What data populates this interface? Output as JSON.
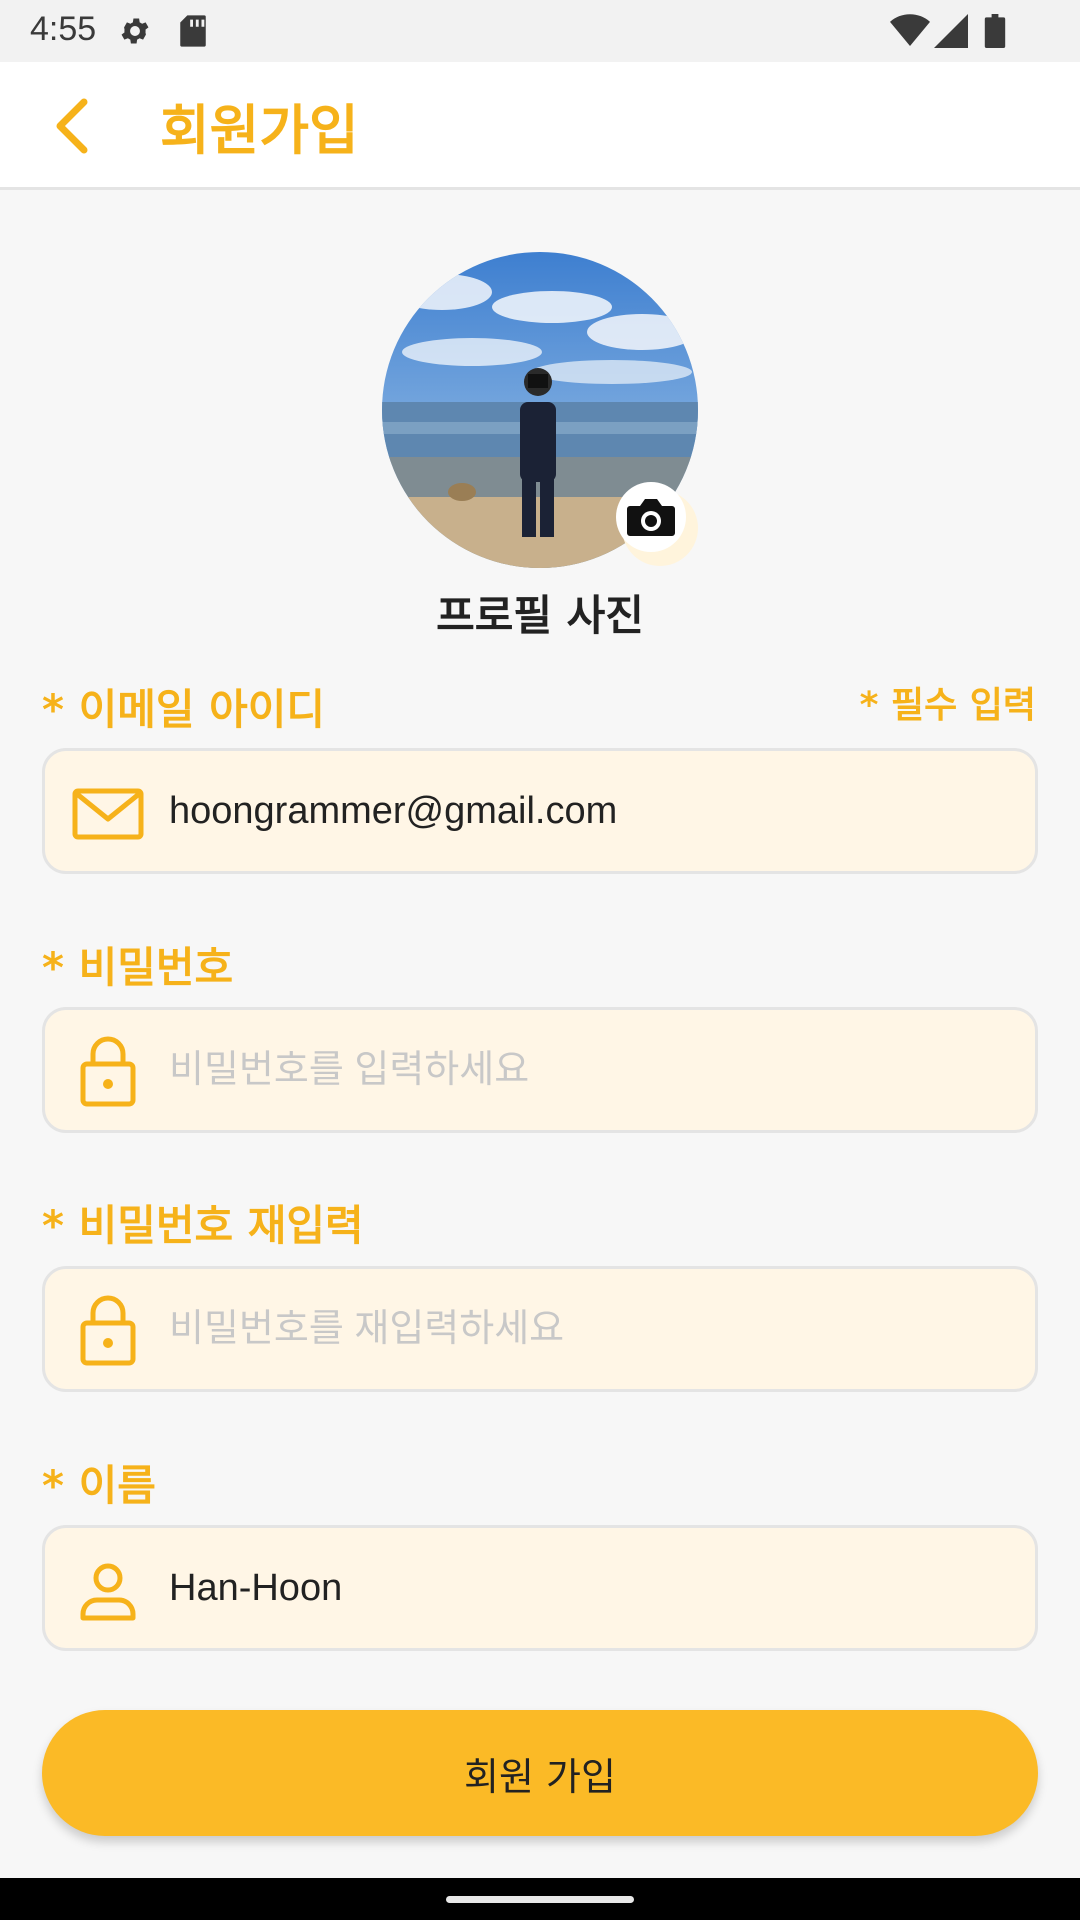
{
  "status_bar": {
    "time": "4:55",
    "left_icons": [
      "settings-icon",
      "sd-card-icon"
    ],
    "right_icons": [
      "wifi-icon",
      "cellular-icon",
      "battery-icon"
    ]
  },
  "app_bar": {
    "back_icon": "chevron-left-icon",
    "title": "회원가입"
  },
  "profile": {
    "label": "프로필 사진",
    "camera_icon": "camera-icon"
  },
  "required_note": "* 필수 입력",
  "fields": {
    "email": {
      "label": "* 이메일 아이디",
      "icon": "mail-icon",
      "value": "hoongrammer@gmail.com",
      "placeholder": ""
    },
    "password": {
      "label": "* 비밀번호",
      "icon": "lock-icon",
      "value": "",
      "placeholder": "비밀번호를 입력하세요"
    },
    "password_confirm": {
      "label": "* 비밀번호 재입력",
      "icon": "lock-icon",
      "value": "",
      "placeholder": "비밀번호를 재입력하세요"
    },
    "name": {
      "label": "* 이름",
      "icon": "person-icon",
      "value": "Han-Hoon",
      "placeholder": ""
    }
  },
  "submit_button": "회원 가입",
  "colors": {
    "accent": "#F6B21A",
    "button": "#FBBA26",
    "field_bg": "#FFF6E6",
    "background": "#F7F7F7"
  }
}
